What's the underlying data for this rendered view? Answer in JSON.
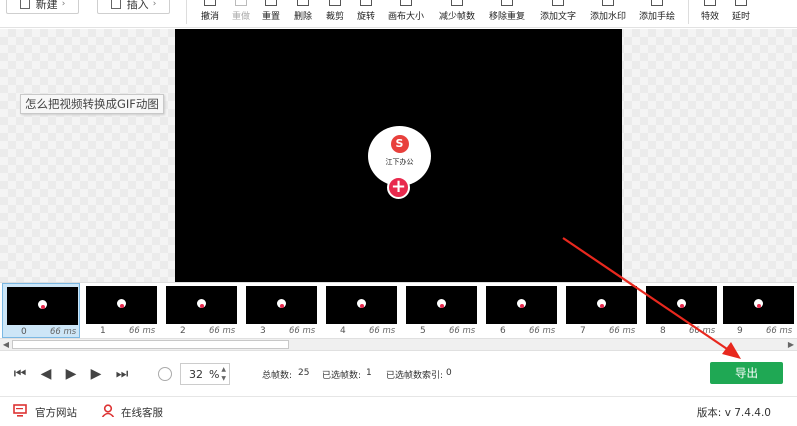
{
  "toolbar": {
    "new_label": "新建",
    "insert_label": "插入",
    "tools": [
      {
        "label": "撤消",
        "enabled": true
      },
      {
        "label": "重做",
        "enabled": false
      },
      {
        "label": "重置",
        "enabled": true
      },
      {
        "label": "删除",
        "enabled": true
      },
      {
        "label": "裁剪",
        "enabled": true
      },
      {
        "label": "旋转",
        "enabled": true
      },
      {
        "label": "画布大小",
        "enabled": true
      },
      {
        "label": "减少帧数",
        "enabled": true
      },
      {
        "label": "移除重复",
        "enabled": true
      },
      {
        "label": "添加文字",
        "enabled": true
      },
      {
        "label": "添加水印",
        "enabled": true
      },
      {
        "label": "添加手绘",
        "enabled": true
      },
      {
        "label": "特效",
        "enabled": true
      },
      {
        "label": "延时",
        "enabled": true
      }
    ]
  },
  "stage": {
    "caption": "怎么把视频转换成GIF动图",
    "logo_text": "江下办公",
    "add_symbol": "+"
  },
  "filmstrip": {
    "frames": [
      {
        "index": "0",
        "duration": "66 ms",
        "selected": true
      },
      {
        "index": "1",
        "duration": "66 ms",
        "selected": false
      },
      {
        "index": "2",
        "duration": "66 ms",
        "selected": false
      },
      {
        "index": "3",
        "duration": "66 ms",
        "selected": false
      },
      {
        "index": "4",
        "duration": "66 ms",
        "selected": false
      },
      {
        "index": "5",
        "duration": "66 ms",
        "selected": false
      },
      {
        "index": "6",
        "duration": "66 ms",
        "selected": false
      },
      {
        "index": "7",
        "duration": "66 ms",
        "selected": false
      },
      {
        "index": "8",
        "duration": "66 ms",
        "selected": false
      },
      {
        "index": "9",
        "duration": "66 ms",
        "selected": false
      }
    ]
  },
  "controls": {
    "zoom_value": "32",
    "zoom_unit": "%",
    "total_frames_label": "总帧数:",
    "total_frames": "25",
    "selected_frames_label": "已选帧数:",
    "selected_frames": "1",
    "selected_index_label": "已选帧数索引:",
    "selected_index": "0",
    "export_label": "导出"
  },
  "footer": {
    "website_label": "官方网站",
    "support_label": "在线客服",
    "version_label": "版本:",
    "version_value": "v 7.4.4.0"
  },
  "colors": {
    "export_green": "#1fa854",
    "accent_red": "#e8294d",
    "selection_blue": "#cde6f7"
  },
  "icons": {
    "new": "new-file-icon",
    "insert": "insert-icon",
    "first": "first-frame-icon",
    "prev": "prev-frame-icon",
    "play": "play-icon",
    "next": "next-frame-icon",
    "last": "last-frame-icon",
    "zoom": "zoom-icon",
    "website": "monitor-icon",
    "support": "user-icon"
  }
}
